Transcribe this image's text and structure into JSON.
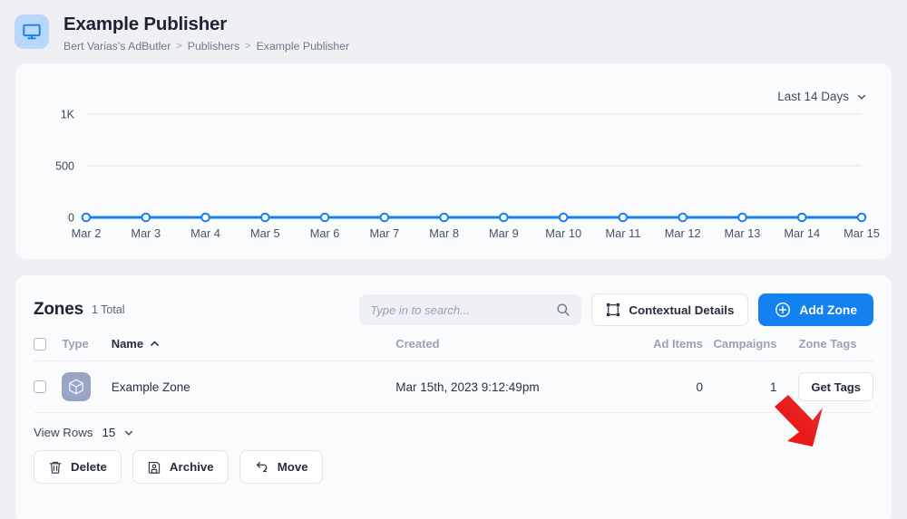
{
  "header": {
    "icon": "monitor-icon",
    "title": "Example Publisher",
    "breadcrumb": [
      "Bert Varias's AdButler",
      "Publishers",
      "Example Publisher"
    ],
    "separator": ">",
    "icon_bg": "#b9d7fb",
    "icon_color": "#1481f0"
  },
  "chart_card": {
    "range_label": "Last 14 Days",
    "range_icon": "chevron-down-icon"
  },
  "chart_data": {
    "type": "line",
    "title": "",
    "xlabel": "",
    "ylabel": "",
    "x": [
      "Mar 2",
      "Mar 3",
      "Mar 4",
      "Mar 5",
      "Mar 6",
      "Mar 7",
      "Mar 8",
      "Mar 9",
      "Mar 10",
      "Mar 11",
      "Mar 12",
      "Mar 13",
      "Mar 14",
      "Mar 15"
    ],
    "values": [
      0,
      0,
      0,
      0,
      0,
      0,
      0,
      0,
      0,
      0,
      0,
      0,
      0,
      0
    ],
    "ytick_labels": [
      "0",
      "500",
      "1K"
    ],
    "ytick_values": [
      0,
      500,
      1000
    ],
    "ylim": [
      0,
      1000
    ],
    "grid": true,
    "legend": "none",
    "line_color": "#1481f0",
    "marker": "open-circle"
  },
  "zones": {
    "title": "Zones",
    "count_label": "1 Total",
    "search": {
      "placeholder": "Type in to search...",
      "value": "",
      "icon": "search-icon"
    },
    "contextual_details": {
      "label": "Contextual Details",
      "icon": "frame-select-icon"
    },
    "add_zone": {
      "label": "Add Zone",
      "icon": "plus-circle-icon",
      "color": "#1481f0"
    },
    "columns": [
      "Type",
      "Name",
      "Created",
      "Ad Items",
      "Campaigns",
      "Zone Tags"
    ],
    "sort": {
      "column": "Name",
      "direction": "asc",
      "icon": "chevron-up-icon"
    },
    "rows": [
      {
        "checked": false,
        "type_icon": "cube-icon",
        "name": "Example Zone",
        "created": "Mar 15th, 2023 9:12:49pm",
        "ad_items": "0",
        "campaigns": "1",
        "zone_tags_label": "Get Tags"
      }
    ]
  },
  "footer": {
    "view_rows_label": "View Rows",
    "view_rows_value": "15",
    "view_rows_icon": "chevron-down-icon",
    "buttons": [
      {
        "label": "Delete",
        "icon": "trash-icon"
      },
      {
        "label": "Archive",
        "icon": "save-disk-icon"
      },
      {
        "label": "Move",
        "icon": "move-arrows-icon"
      }
    ]
  },
  "annotation": {
    "type": "red-arrow",
    "color": "#e81c1c",
    "points_to": "Get Tags"
  }
}
